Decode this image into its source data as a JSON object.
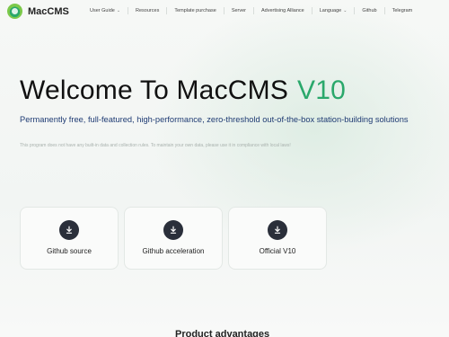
{
  "brand": {
    "name": "MacCMS"
  },
  "nav": {
    "items": [
      {
        "label": "User Guide",
        "dropdown": true
      },
      {
        "label": "Resources",
        "dropdown": false
      },
      {
        "label": "Template purchase",
        "dropdown": false
      },
      {
        "label": "Server",
        "dropdown": false
      },
      {
        "label": "Advertising Alliance",
        "dropdown": false
      },
      {
        "label": "Language",
        "dropdown": true
      },
      {
        "label": "Github",
        "dropdown": false
      },
      {
        "label": "Telegram",
        "dropdown": false
      }
    ],
    "chevron": "⌄"
  },
  "hero": {
    "title": "Welcome To MacCMS",
    "version": "V10",
    "subtitle": "Permanently free, full-featured, high-performance, zero-threshold out-of-the-box station-building solutions",
    "note": "This program does not have any built-in data and collection rules. To maintain your own data, please use it in compliance with local laws!"
  },
  "downloads": [
    {
      "label": "Github source",
      "icon": "download-icon"
    },
    {
      "label": "Github acceleration",
      "icon": "download-icon"
    },
    {
      "label": "Official V10",
      "icon": "download-icon"
    }
  ],
  "sections": {
    "advantages_title": "Product advantages"
  },
  "colors": {
    "accent": "#2aa86b",
    "subtitle": "#1f3b73",
    "button": "#2a2f3a",
    "background": "#f3f6f4"
  }
}
